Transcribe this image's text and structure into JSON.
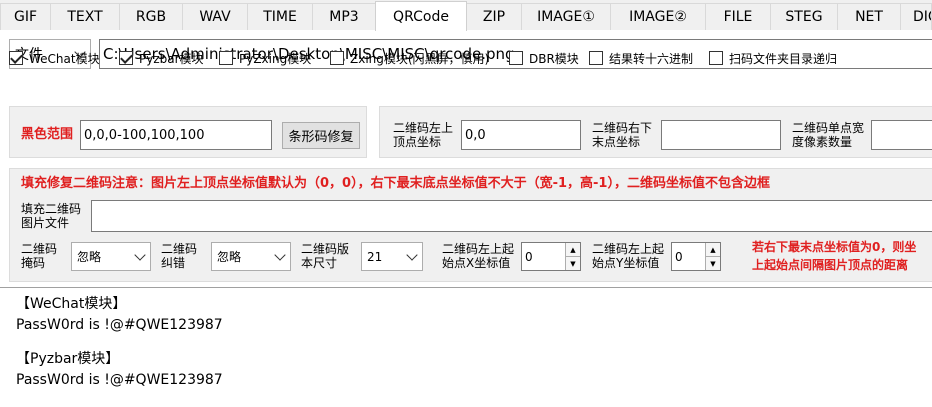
{
  "tabs": [
    "GIF",
    "TEXT",
    "RGB",
    "WAV",
    "TIME",
    "MP3",
    "QRCode",
    "ZIP",
    "IMAGE①",
    "IMAGE②",
    "FILE",
    "STEG",
    "NET",
    "DIC"
  ],
  "active_tab": "QRCode",
  "file_row": {
    "type_label": "文件",
    "path": "C:\\Users\\Administrator\\Desktop\\MISC\\MISC\\qrcode.png"
  },
  "checkboxes": [
    {
      "label": "WeChat模块",
      "checked": true
    },
    {
      "label": "Pyzbar模块",
      "checked": true
    },
    {
      "label": "PyZxing模块",
      "checked": false
    },
    {
      "label": "Zxing模块(闪黑屏，慎用)",
      "checked": false
    },
    {
      "label": "DBR模块",
      "checked": false
    },
    {
      "label": "结果转十六进制",
      "checked": false
    },
    {
      "label": "扫码文件夹目录递归",
      "checked": false
    }
  ],
  "black_range": {
    "label": "黑色范围",
    "value": "0,0,0-100,100,100",
    "button": "条形码修复"
  },
  "qr_coords": {
    "top_left_label": "二维码左上\n顶点坐标",
    "top_left_value": "0,0",
    "bottom_right_label": "二维码右下\n末点坐标",
    "bottom_right_value": "",
    "pixel_label": "二维码单点宽\n度像素数量",
    "pixel_value": ""
  },
  "notice": "填充修复二维码注意：图片左上顶点坐标值默认为（0，0），右下最末底点坐标值不大于（宽-1，高-1），二维码坐标值不包含边框",
  "fill_file": {
    "label": "填充二维码\n图片文件",
    "value": ""
  },
  "options": {
    "mask_label": "二维码\n掩码",
    "mask_value": "忽略",
    "ecc_label": "二维码\n纠错",
    "ecc_value": "忽略",
    "version_label": "二维码版\n本尺寸",
    "version_value": "21",
    "start_x_label": "二维码左上起\n始点X坐标值",
    "start_x_value": "0",
    "start_y_label": "二维码左上起\n始点Y坐标值",
    "start_y_value": "0",
    "hint_line1": "若右下最末点坐标值为0，则坐",
    "hint_line2": "上起始点间隔图片顶点的距离"
  },
  "output": {
    "wechat_header": "【WeChat模块】",
    "wechat_result": "PassW0rd is !@#QWE123987",
    "pyzbar_header": "【Pyzbar模块】",
    "pyzbar_result": "PassW0rd is !@#QWE123987"
  }
}
